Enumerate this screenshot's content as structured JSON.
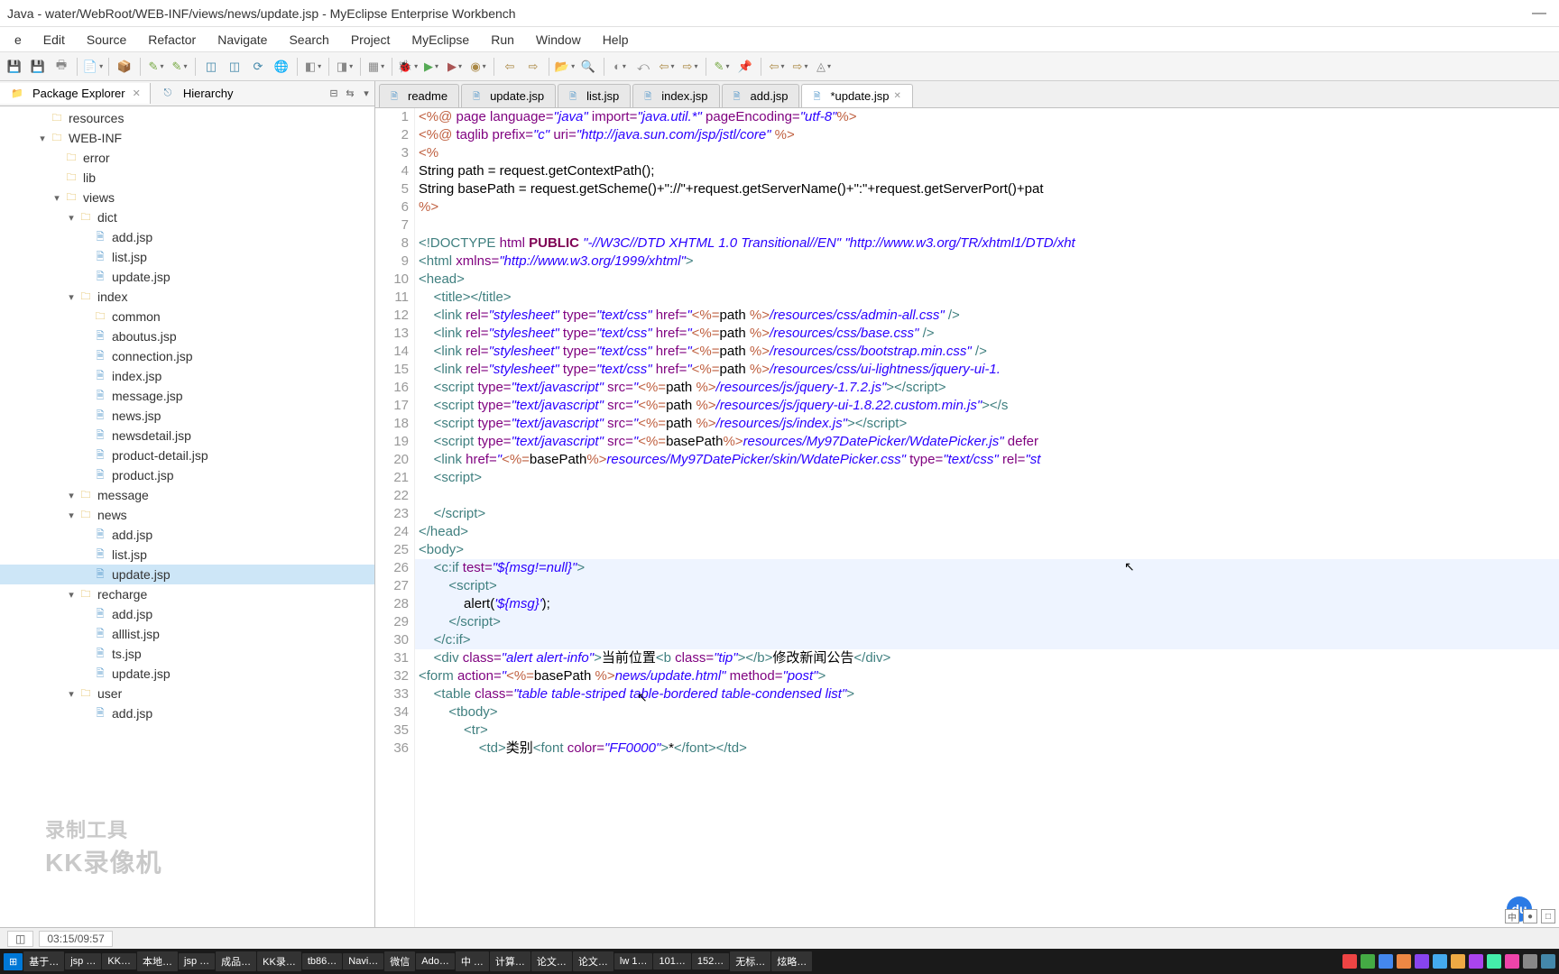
{
  "title": "Java - water/WebRoot/WEB-INF/views/news/update.jsp - MyEclipse Enterprise Workbench",
  "menu": [
    "e",
    "Edit",
    "Source",
    "Refactor",
    "Navigate",
    "Search",
    "Project",
    "MyEclipse",
    "Run",
    "Window",
    "Help"
  ],
  "views": {
    "pkg": "Package Explorer",
    "hier": "Hierarchy"
  },
  "tree": [
    {
      "lvl": 1,
      "exp": "",
      "icon": "folder",
      "label": "resources"
    },
    {
      "lvl": 1,
      "exp": "▾",
      "icon": "folder",
      "label": "WEB-INF"
    },
    {
      "lvl": 2,
      "exp": "",
      "icon": "folder",
      "label": "error"
    },
    {
      "lvl": 2,
      "exp": "",
      "icon": "folder",
      "label": "lib"
    },
    {
      "lvl": 2,
      "exp": "▾",
      "icon": "folder",
      "label": "views"
    },
    {
      "lvl": 3,
      "exp": "▾",
      "icon": "folder",
      "label": "dict"
    },
    {
      "lvl": 4,
      "exp": "",
      "icon": "jsp",
      "label": "add.jsp"
    },
    {
      "lvl": 4,
      "exp": "",
      "icon": "jsp",
      "label": "list.jsp"
    },
    {
      "lvl": 4,
      "exp": "",
      "icon": "jsp",
      "label": "update.jsp"
    },
    {
      "lvl": 3,
      "exp": "▾",
      "icon": "folder",
      "label": "index"
    },
    {
      "lvl": 4,
      "exp": "",
      "icon": "folder",
      "label": "common"
    },
    {
      "lvl": 4,
      "exp": "",
      "icon": "jsp",
      "label": "aboutus.jsp"
    },
    {
      "lvl": 4,
      "exp": "",
      "icon": "jsp",
      "label": "connection.jsp"
    },
    {
      "lvl": 4,
      "exp": "",
      "icon": "jsp",
      "label": "index.jsp"
    },
    {
      "lvl": 4,
      "exp": "",
      "icon": "jsp",
      "label": "message.jsp"
    },
    {
      "lvl": 4,
      "exp": "",
      "icon": "jsp",
      "label": "news.jsp"
    },
    {
      "lvl": 4,
      "exp": "",
      "icon": "jsp",
      "label": "newsdetail.jsp"
    },
    {
      "lvl": 4,
      "exp": "",
      "icon": "jsp",
      "label": "product-detail.jsp"
    },
    {
      "lvl": 4,
      "exp": "",
      "icon": "jsp",
      "label": "product.jsp"
    },
    {
      "lvl": 3,
      "exp": "▾",
      "icon": "folder",
      "label": "message"
    },
    {
      "lvl": 3,
      "exp": "▾",
      "icon": "folder",
      "label": "news"
    },
    {
      "lvl": 4,
      "exp": "",
      "icon": "jsp",
      "label": "add.jsp"
    },
    {
      "lvl": 4,
      "exp": "",
      "icon": "jsp",
      "label": "list.jsp"
    },
    {
      "lvl": 4,
      "exp": "",
      "icon": "jsp",
      "label": "update.jsp",
      "sel": true
    },
    {
      "lvl": 3,
      "exp": "▾",
      "icon": "folder",
      "label": "recharge"
    },
    {
      "lvl": 4,
      "exp": "",
      "icon": "jsp",
      "label": "add.jsp"
    },
    {
      "lvl": 4,
      "exp": "",
      "icon": "jsp",
      "label": "alllist.jsp"
    },
    {
      "lvl": 4,
      "exp": "",
      "icon": "jsp",
      "label": "ts.jsp"
    },
    {
      "lvl": 4,
      "exp": "",
      "icon": "jsp",
      "label": "update.jsp"
    },
    {
      "lvl": 3,
      "exp": "▾",
      "icon": "folder",
      "label": "user"
    },
    {
      "lvl": 4,
      "exp": "",
      "icon": "jsp",
      "label": "add.jsp"
    }
  ],
  "edtabs": [
    {
      "label": "readme",
      "active": false
    },
    {
      "label": "update.jsp",
      "active": false
    },
    {
      "label": "list.jsp",
      "active": false
    },
    {
      "label": "index.jsp",
      "active": false
    },
    {
      "label": "add.jsp",
      "active": false
    },
    {
      "label": "*update.jsp",
      "active": true,
      "close": true
    }
  ],
  "status": {
    "time": "03:15/09:57"
  },
  "taskbar": [
    "基于…",
    "jsp …",
    "KK…",
    "本地…",
    "jsp …",
    "成品…",
    "KK录…",
    "tb86…",
    "Navi…",
    "微信",
    "Ado…",
    "中 …",
    "计算…",
    "论文…",
    "论文…",
    "lw 1…",
    "101…",
    "152…",
    "无标…",
    "炫略…"
  ],
  "du": "du",
  "watermark1": "录制工具",
  "watermark2": "KK录像机",
  "ime": [
    "中",
    "●",
    "□"
  ]
}
